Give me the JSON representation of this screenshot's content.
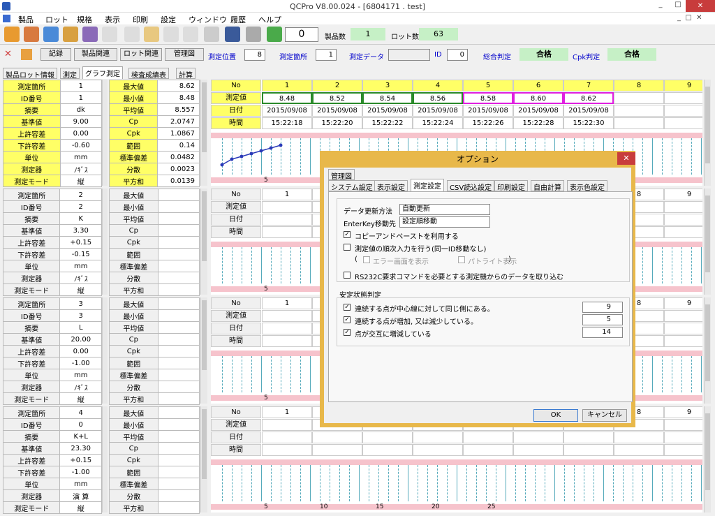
{
  "window": {
    "title": "QCPro V8.00.024 - [6804171 . test]",
    "min": "_",
    "max": "□",
    "close": "✕"
  },
  "menu": [
    "製品",
    "ロット",
    "規格",
    "表示",
    "印刷",
    "設定",
    "ウィンドウ",
    "履歴",
    "ヘルプ"
  ],
  "toolbar": {
    "counter": "0",
    "prod_count_label": "製品数",
    "prod_count": "1",
    "lot_count_label": "ロット数",
    "lot_count": "63"
  },
  "toolbar2": {
    "record": "記録",
    "product_related": "製品関連",
    "lot_related": "ロット関連",
    "control_chart": "管理図",
    "pos_label": "測定位置",
    "pos": "8",
    "point_label": "測定箇所",
    "point": "1",
    "data_label": "測定データ",
    "id_label": "ID",
    "id": "0",
    "overall_label": "総合判定",
    "overall": "合格",
    "cpk_label": "Cpk判定",
    "cpk": "合格"
  },
  "tabs": [
    "製品ロット情報",
    "測定",
    "グラフ測定",
    "検査成績表",
    "計算"
  ],
  "labels_left": [
    "測定箇所",
    "ID番号",
    "摘要",
    "基準値",
    "上許容差",
    "下許容差",
    "単位",
    "測定器",
    "測定モード"
  ],
  "labels_stat": [
    "最大値",
    "最小値",
    "平均値",
    "Cp",
    "Cpk",
    "範囲",
    "標準偏差",
    "分散",
    "平方和"
  ],
  "blocks": [
    {
      "vals": [
        "1",
        "1",
        "dk",
        "9.00",
        "0.00",
        "-0.60",
        "mm",
        "ﾉｷﾞｽ",
        "縦"
      ],
      "stats": [
        "8.62",
        "8.48",
        "8.557",
        "2.0747",
        "1.0867",
        "0.14",
        "0.0482",
        "0.0023",
        "0.0139"
      ]
    },
    {
      "vals": [
        "2",
        "2",
        "K",
        "3.30",
        "+0.15",
        "-0.15",
        "mm",
        "ﾉｷﾞｽ",
        "縦"
      ],
      "stats": [
        "",
        "",
        "",
        "",
        "",
        "",
        "",
        "",
        ""
      ]
    },
    {
      "vals": [
        "3",
        "3",
        "L",
        "20.00",
        "0.00",
        "-1.00",
        "mm",
        "ﾉｷﾞｽ",
        "縦"
      ],
      "stats": [
        "",
        "",
        "",
        "",
        "",
        "",
        "",
        "",
        ""
      ]
    },
    {
      "vals": [
        "4",
        "0",
        "K+L",
        "23.30",
        "+0.15",
        "-1.00",
        "mm",
        "演 算",
        "縦"
      ],
      "stats": [
        "",
        "",
        "",
        "",
        "",
        "",
        "",
        "",
        ""
      ]
    }
  ],
  "grid": {
    "row_labels": [
      "No",
      "測定値",
      "日付",
      "時間"
    ],
    "cols": [
      "1",
      "2",
      "3",
      "4",
      "5",
      "6",
      "7",
      "8",
      "9"
    ],
    "values": [
      "8.48",
      "8.52",
      "8.54",
      "8.56",
      "8.58",
      "8.60",
      "8.62",
      "",
      ""
    ],
    "dates": [
      "2015/09/08",
      "2015/09/08",
      "2015/09/08",
      "2015/09/08",
      "2015/09/08",
      "2015/09/08",
      "2015/09/08",
      "",
      ""
    ],
    "times": [
      "15:22:18",
      "15:22:20",
      "15:22:22",
      "15:22:24",
      "15:22:26",
      "15:22:28",
      "15:22:30",
      "",
      ""
    ],
    "axis": [
      "5",
      "10",
      "15",
      "20",
      "25"
    ]
  },
  "colors": {
    "good": "#2a8a2a",
    "warn": "#e020e0",
    "yellow": "#ffff66",
    "pink": "#f6c3cc"
  },
  "dialog": {
    "title": "オプション",
    "close": "✕",
    "tab_top": "管理図",
    "tabs": [
      "システム設定",
      "表示設定",
      "測定設定",
      "CSV読込設定",
      "印刷設定",
      "自由計算",
      "表示色設定"
    ],
    "update_label": "データ更新方法",
    "update_value": "自動更新",
    "enter_label": "EnterKey移動先",
    "enter_value": "設定順移動",
    "copy_paste": "コピーアンドペーストを利用する",
    "sequential": "測定値の順次入力を行う(同一ID移動なし)",
    "open_paren": "(",
    "close_paren": ")",
    "error_screen": "エラー画面を表示",
    "patlite": "パトライト表示",
    "rs232c": "RS232C要求コマンドを必要とする測定機からのデータを取り込む",
    "stability": "安定状態判定",
    "rule1": "連続する点が中心線に対して同じ側にある。",
    "rule1_val": "9",
    "rule2": "連続する点が増加, 又は減少している。",
    "rule2_val": "5",
    "rule3": "点が交互に増減している",
    "rule3_val": "14",
    "ok": "OK",
    "cancel": "キャンセル"
  }
}
